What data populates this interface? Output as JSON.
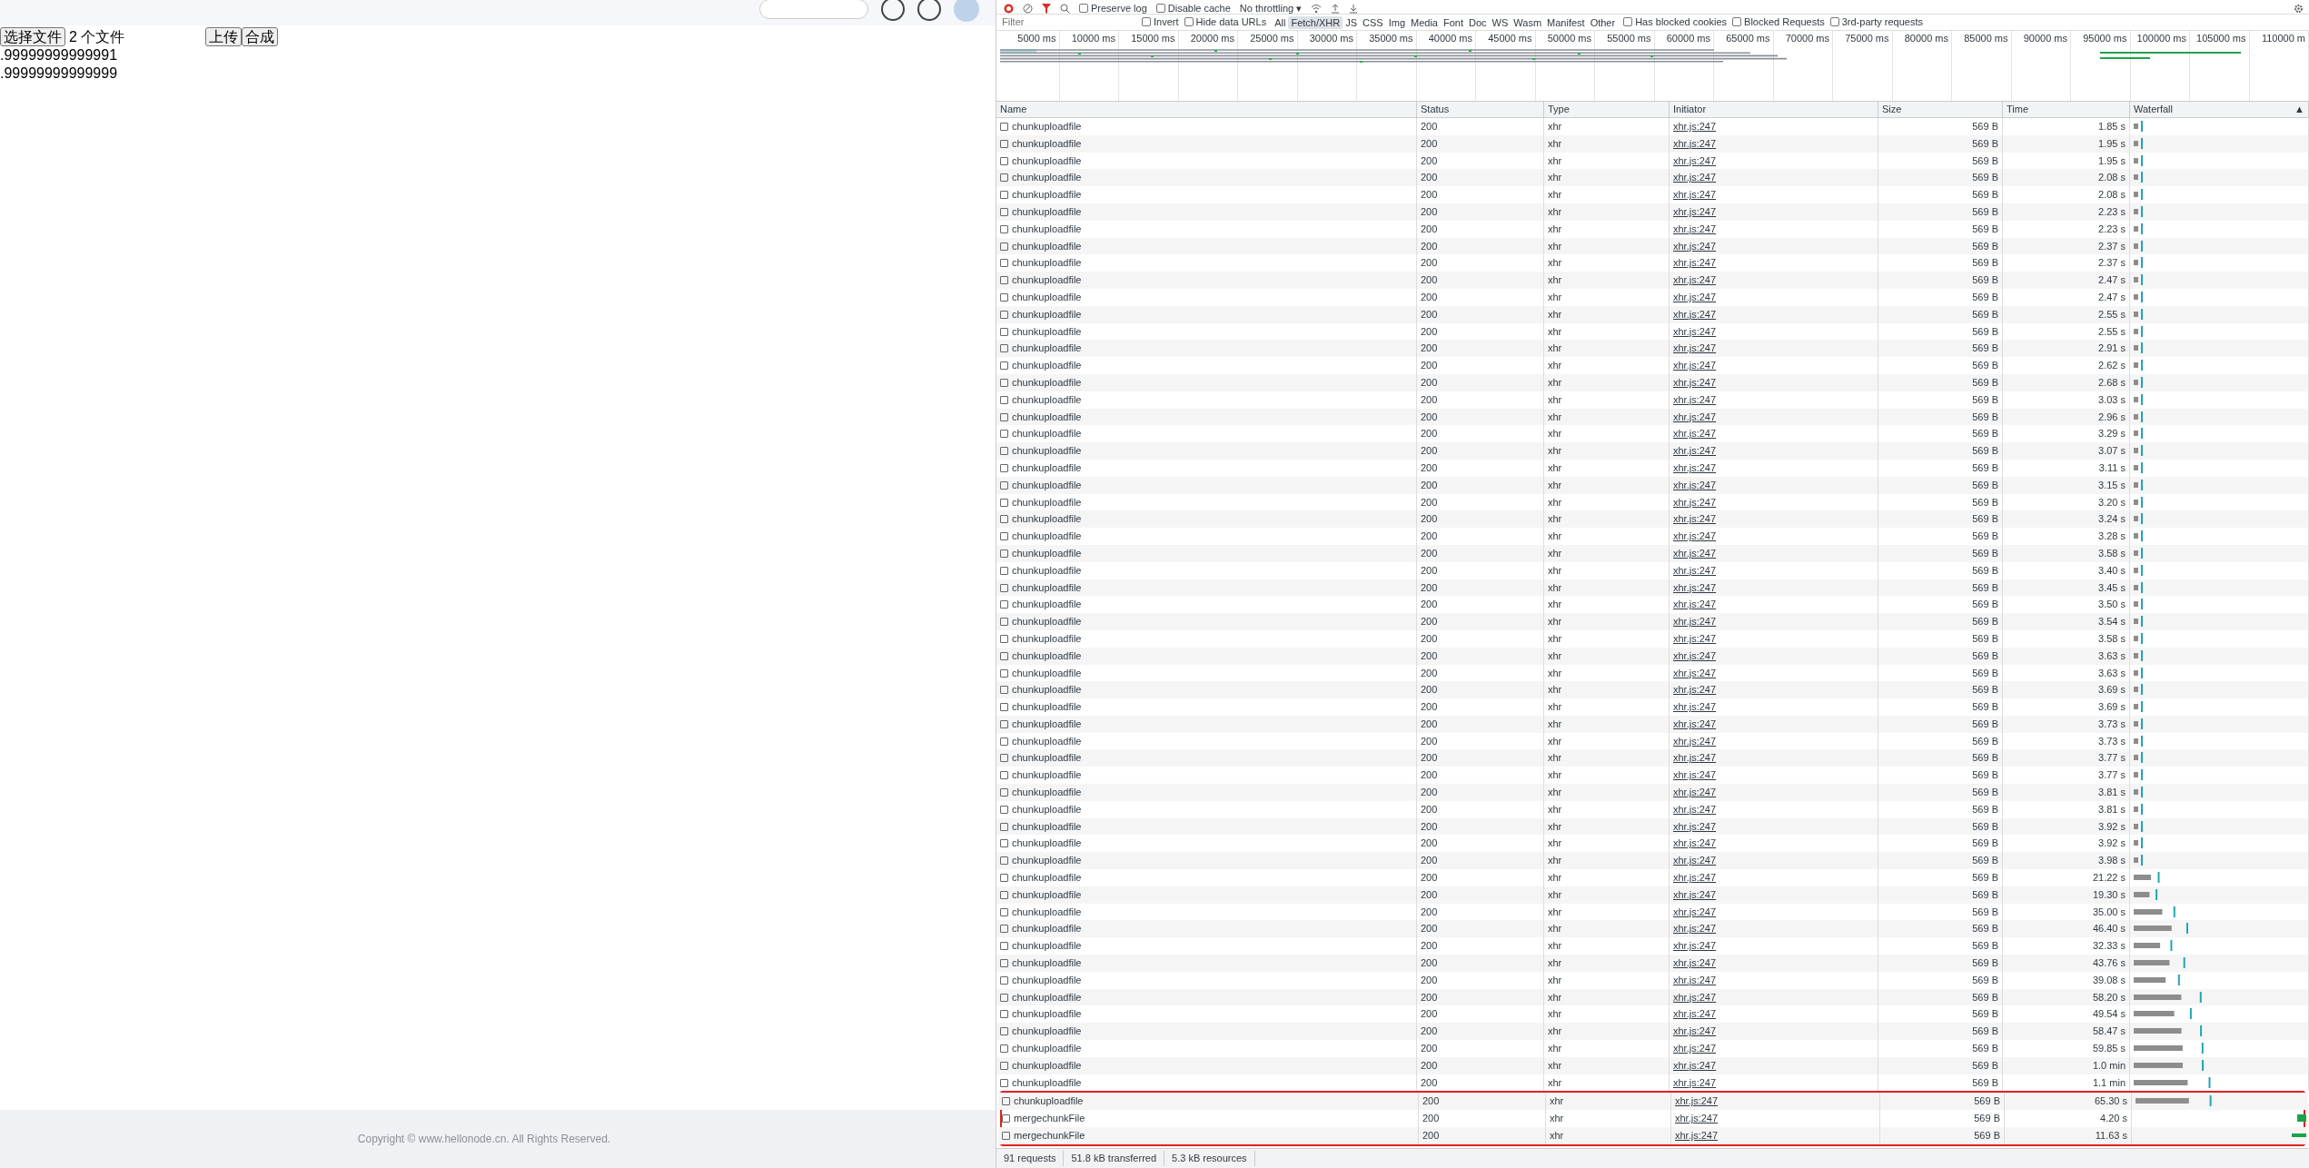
{
  "page": {
    "file_button": "选择文件",
    "file_count": "2 个文件",
    "upload_button": "上传",
    "merge_button": "合成",
    "progress_lines": [
      ".99999999999991",
      ".99999999999999"
    ],
    "footer": "Copyright © www.hellonode.cn. All Rights Reserved."
  },
  "devtools": {
    "toolbar": {
      "preserve_log": {
        "label": "Preserve log",
        "checked": false
      },
      "disable_cache": {
        "label": "Disable cache",
        "checked": false
      },
      "throttling": "No throttling",
      "throttling_caret": "▾"
    },
    "filter": {
      "placeholder": "Filter",
      "checks": [
        {
          "label": "Invert",
          "checked": false
        },
        {
          "label": "Hide data URLs",
          "checked": false
        }
      ],
      "types": [
        {
          "label": "All",
          "selected": false
        },
        {
          "label": "Fetch/XHR",
          "selected": true
        },
        {
          "label": "JS",
          "selected": false
        },
        {
          "label": "CSS",
          "selected": false
        },
        {
          "label": "Img",
          "selected": false
        },
        {
          "label": "Media",
          "selected": false
        },
        {
          "label": "Font",
          "selected": false
        },
        {
          "label": "Doc",
          "selected": false
        },
        {
          "label": "WS",
          "selected": false
        },
        {
          "label": "Wasm",
          "selected": false
        },
        {
          "label": "Manifest",
          "selected": false
        },
        {
          "label": "Other",
          "selected": false
        }
      ],
      "checks_right": [
        {
          "label": "Has blocked cookies",
          "checked": false
        },
        {
          "label": "Blocked Requests",
          "checked": false
        },
        {
          "label": "3rd-party requests",
          "checked": false
        }
      ]
    },
    "timeline_ticks": [
      "5000 ms",
      "10000 ms",
      "15000 ms",
      "20000 ms",
      "25000 ms",
      "30000 ms",
      "35000 ms",
      "40000 ms",
      "45000 ms",
      "50000 ms",
      "55000 ms",
      "60000 ms",
      "65000 ms",
      "70000 ms",
      "75000 ms",
      "80000 ms",
      "85000 ms",
      "90000 ms",
      "95000 ms",
      "100000 ms",
      "105000 ms",
      "110000 m"
    ],
    "columns": [
      "Name",
      "Status",
      "Type",
      "Initiator",
      "Size",
      "Time",
      "Waterfall"
    ],
    "sort_indicator": "▲",
    "rows": [
      {
        "name": "chunkuploadfile",
        "status": "200",
        "type": "xhr",
        "initiator": "xhr.js:247",
        "size": "569 B",
        "time": "1.85 s",
        "kind": "chunk",
        "highlighted": false
      },
      {
        "name": "chunkuploadfile",
        "status": "200",
        "type": "xhr",
        "initiator": "xhr.js:247",
        "size": "569 B",
        "time": "1.95 s",
        "kind": "chunk",
        "highlighted": false
      },
      {
        "name": "chunkuploadfile",
        "status": "200",
        "type": "xhr",
        "initiator": "xhr.js:247",
        "size": "569 B",
        "time": "1.95 s",
        "kind": "chunk",
        "highlighted": false
      },
      {
        "name": "chunkuploadfile",
        "status": "200",
        "type": "xhr",
        "initiator": "xhr.js:247",
        "size": "569 B",
        "time": "2.08 s",
        "kind": "chunk",
        "highlighted": false
      },
      {
        "name": "chunkuploadfile",
        "status": "200",
        "type": "xhr",
        "initiator": "xhr.js:247",
        "size": "569 B",
        "time": "2.08 s",
        "kind": "chunk",
        "highlighted": false
      },
      {
        "name": "chunkuploadfile",
        "status": "200",
        "type": "xhr",
        "initiator": "xhr.js:247",
        "size": "569 B",
        "time": "2.23 s",
        "kind": "chunk",
        "highlighted": false
      },
      {
        "name": "chunkuploadfile",
        "status": "200",
        "type": "xhr",
        "initiator": "xhr.js:247",
        "size": "569 B",
        "time": "2.23 s",
        "kind": "chunk",
        "highlighted": false
      },
      {
        "name": "chunkuploadfile",
        "status": "200",
        "type": "xhr",
        "initiator": "xhr.js:247",
        "size": "569 B",
        "time": "2.37 s",
        "kind": "chunk",
        "highlighted": false
      },
      {
        "name": "chunkuploadfile",
        "status": "200",
        "type": "xhr",
        "initiator": "xhr.js:247",
        "size": "569 B",
        "time": "2.37 s",
        "kind": "chunk",
        "highlighted": false
      },
      {
        "name": "chunkuploadfile",
        "status": "200",
        "type": "xhr",
        "initiator": "xhr.js:247",
        "size": "569 B",
        "time": "2.47 s",
        "kind": "chunk",
        "highlighted": false
      },
      {
        "name": "chunkuploadfile",
        "status": "200",
        "type": "xhr",
        "initiator": "xhr.js:247",
        "size": "569 B",
        "time": "2.47 s",
        "kind": "chunk",
        "highlighted": false
      },
      {
        "name": "chunkuploadfile",
        "status": "200",
        "type": "xhr",
        "initiator": "xhr.js:247",
        "size": "569 B",
        "time": "2.55 s",
        "kind": "chunk",
        "highlighted": false
      },
      {
        "name": "chunkuploadfile",
        "status": "200",
        "type": "xhr",
        "initiator": "xhr.js:247",
        "size": "569 B",
        "time": "2.55 s",
        "kind": "chunk",
        "highlighted": false
      },
      {
        "name": "chunkuploadfile",
        "status": "200",
        "type": "xhr",
        "initiator": "xhr.js:247",
        "size": "569 B",
        "time": "2.91 s",
        "kind": "chunk",
        "highlighted": false
      },
      {
        "name": "chunkuploadfile",
        "status": "200",
        "type": "xhr",
        "initiator": "xhr.js:247",
        "size": "569 B",
        "time": "2.62 s",
        "kind": "chunk",
        "highlighted": false
      },
      {
        "name": "chunkuploadfile",
        "status": "200",
        "type": "xhr",
        "initiator": "xhr.js:247",
        "size": "569 B",
        "time": "2.68 s",
        "kind": "chunk",
        "highlighted": false
      },
      {
        "name": "chunkuploadfile",
        "status": "200",
        "type": "xhr",
        "initiator": "xhr.js:247",
        "size": "569 B",
        "time": "3.03 s",
        "kind": "chunk",
        "highlighted": false
      },
      {
        "name": "chunkuploadfile",
        "status": "200",
        "type": "xhr",
        "initiator": "xhr.js:247",
        "size": "569 B",
        "time": "2.96 s",
        "kind": "chunk",
        "highlighted": false
      },
      {
        "name": "chunkuploadfile",
        "status": "200",
        "type": "xhr",
        "initiator": "xhr.js:247",
        "size": "569 B",
        "time": "3.29 s",
        "kind": "chunk",
        "highlighted": false
      },
      {
        "name": "chunkuploadfile",
        "status": "200",
        "type": "xhr",
        "initiator": "xhr.js:247",
        "size": "569 B",
        "time": "3.07 s",
        "kind": "chunk",
        "highlighted": false
      },
      {
        "name": "chunkuploadfile",
        "status": "200",
        "type": "xhr",
        "initiator": "xhr.js:247",
        "size": "569 B",
        "time": "3.11 s",
        "kind": "chunk",
        "highlighted": false
      },
      {
        "name": "chunkuploadfile",
        "status": "200",
        "type": "xhr",
        "initiator": "xhr.js:247",
        "size": "569 B",
        "time": "3.15 s",
        "kind": "chunk",
        "highlighted": false
      },
      {
        "name": "chunkuploadfile",
        "status": "200",
        "type": "xhr",
        "initiator": "xhr.js:247",
        "size": "569 B",
        "time": "3.20 s",
        "kind": "chunk",
        "highlighted": false
      },
      {
        "name": "chunkuploadfile",
        "status": "200",
        "type": "xhr",
        "initiator": "xhr.js:247",
        "size": "569 B",
        "time": "3.24 s",
        "kind": "chunk",
        "highlighted": false
      },
      {
        "name": "chunkuploadfile",
        "status": "200",
        "type": "xhr",
        "initiator": "xhr.js:247",
        "size": "569 B",
        "time": "3.28 s",
        "kind": "chunk",
        "highlighted": false
      },
      {
        "name": "chunkuploadfile",
        "status": "200",
        "type": "xhr",
        "initiator": "xhr.js:247",
        "size": "569 B",
        "time": "3.58 s",
        "kind": "chunk",
        "highlighted": false
      },
      {
        "name": "chunkuploadfile",
        "status": "200",
        "type": "xhr",
        "initiator": "xhr.js:247",
        "size": "569 B",
        "time": "3.40 s",
        "kind": "chunk",
        "highlighted": false
      },
      {
        "name": "chunkuploadfile",
        "status": "200",
        "type": "xhr",
        "initiator": "xhr.js:247",
        "size": "569 B",
        "time": "3.45 s",
        "kind": "chunk",
        "highlighted": false
      },
      {
        "name": "chunkuploadfile",
        "status": "200",
        "type": "xhr",
        "initiator": "xhr.js:247",
        "size": "569 B",
        "time": "3.50 s",
        "kind": "chunk",
        "highlighted": false
      },
      {
        "name": "chunkuploadfile",
        "status": "200",
        "type": "xhr",
        "initiator": "xhr.js:247",
        "size": "569 B",
        "time": "3.54 s",
        "kind": "chunk",
        "highlighted": false
      },
      {
        "name": "chunkuploadfile",
        "status": "200",
        "type": "xhr",
        "initiator": "xhr.js:247",
        "size": "569 B",
        "time": "3.58 s",
        "kind": "chunk",
        "highlighted": false
      },
      {
        "name": "chunkuploadfile",
        "status": "200",
        "type": "xhr",
        "initiator": "xhr.js:247",
        "size": "569 B",
        "time": "3.63 s",
        "kind": "chunk",
        "highlighted": false
      },
      {
        "name": "chunkuploadfile",
        "status": "200",
        "type": "xhr",
        "initiator": "xhr.js:247",
        "size": "569 B",
        "time": "3.63 s",
        "kind": "chunk",
        "highlighted": false
      },
      {
        "name": "chunkuploadfile",
        "status": "200",
        "type": "xhr",
        "initiator": "xhr.js:247",
        "size": "569 B",
        "time": "3.69 s",
        "kind": "chunk",
        "highlighted": false
      },
      {
        "name": "chunkuploadfile",
        "status": "200",
        "type": "xhr",
        "initiator": "xhr.js:247",
        "size": "569 B",
        "time": "3.69 s",
        "kind": "chunk",
        "highlighted": false
      },
      {
        "name": "chunkuploadfile",
        "status": "200",
        "type": "xhr",
        "initiator": "xhr.js:247",
        "size": "569 B",
        "time": "3.73 s",
        "kind": "chunk",
        "highlighted": false
      },
      {
        "name": "chunkuploadfile",
        "status": "200",
        "type": "xhr",
        "initiator": "xhr.js:247",
        "size": "569 B",
        "time": "3.73 s",
        "kind": "chunk",
        "highlighted": false
      },
      {
        "name": "chunkuploadfile",
        "status": "200",
        "type": "xhr",
        "initiator": "xhr.js:247",
        "size": "569 B",
        "time": "3.77 s",
        "kind": "chunk",
        "highlighted": false
      },
      {
        "name": "chunkuploadfile",
        "status": "200",
        "type": "xhr",
        "initiator": "xhr.js:247",
        "size": "569 B",
        "time": "3.77 s",
        "kind": "chunk",
        "highlighted": false
      },
      {
        "name": "chunkuploadfile",
        "status": "200",
        "type": "xhr",
        "initiator": "xhr.js:247",
        "size": "569 B",
        "time": "3.81 s",
        "kind": "chunk",
        "highlighted": false
      },
      {
        "name": "chunkuploadfile",
        "status": "200",
        "type": "xhr",
        "initiator": "xhr.js:247",
        "size": "569 B",
        "time": "3.81 s",
        "kind": "chunk",
        "highlighted": false
      },
      {
        "name": "chunkuploadfile",
        "status": "200",
        "type": "xhr",
        "initiator": "xhr.js:247",
        "size": "569 B",
        "time": "3.92 s",
        "kind": "chunk",
        "highlighted": false
      },
      {
        "name": "chunkuploadfile",
        "status": "200",
        "type": "xhr",
        "initiator": "xhr.js:247",
        "size": "569 B",
        "time": "3.92 s",
        "kind": "chunk",
        "highlighted": false
      },
      {
        "name": "chunkuploadfile",
        "status": "200",
        "type": "xhr",
        "initiator": "xhr.js:247",
        "size": "569 B",
        "time": "3.98 s",
        "kind": "chunk",
        "highlighted": false
      },
      {
        "name": "chunkuploadfile",
        "status": "200",
        "type": "xhr",
        "initiator": "xhr.js:247",
        "size": "569 B",
        "time": "21.22 s",
        "kind": "chunk",
        "highlighted": false
      },
      {
        "name": "chunkuploadfile",
        "status": "200",
        "type": "xhr",
        "initiator": "xhr.js:247",
        "size": "569 B",
        "time": "19.30 s",
        "kind": "chunk",
        "highlighted": false
      },
      {
        "name": "chunkuploadfile",
        "status": "200",
        "type": "xhr",
        "initiator": "xhr.js:247",
        "size": "569 B",
        "time": "35.00 s",
        "kind": "chunk",
        "highlighted": false
      },
      {
        "name": "chunkuploadfile",
        "status": "200",
        "type": "xhr",
        "initiator": "xhr.js:247",
        "size": "569 B",
        "time": "46.40 s",
        "kind": "chunk",
        "highlighted": false
      },
      {
        "name": "chunkuploadfile",
        "status": "200",
        "type": "xhr",
        "initiator": "xhr.js:247",
        "size": "569 B",
        "time": "32.33 s",
        "kind": "chunk",
        "highlighted": false
      },
      {
        "name": "chunkuploadfile",
        "status": "200",
        "type": "xhr",
        "initiator": "xhr.js:247",
        "size": "569 B",
        "time": "43.76 s",
        "kind": "chunk",
        "highlighted": false
      },
      {
        "name": "chunkuploadfile",
        "status": "200",
        "type": "xhr",
        "initiator": "xhr.js:247",
        "size": "569 B",
        "time": "39.08 s",
        "kind": "chunk",
        "highlighted": false
      },
      {
        "name": "chunkuploadfile",
        "status": "200",
        "type": "xhr",
        "initiator": "xhr.js:247",
        "size": "569 B",
        "time": "58.20 s",
        "kind": "chunk",
        "highlighted": false
      },
      {
        "name": "chunkuploadfile",
        "status": "200",
        "type": "xhr",
        "initiator": "xhr.js:247",
        "size": "569 B",
        "time": "49.54 s",
        "kind": "chunk",
        "highlighted": false
      },
      {
        "name": "chunkuploadfile",
        "status": "200",
        "type": "xhr",
        "initiator": "xhr.js:247",
        "size": "569 B",
        "time": "58.47 s",
        "kind": "chunk",
        "highlighted": false
      },
      {
        "name": "chunkuploadfile",
        "status": "200",
        "type": "xhr",
        "initiator": "xhr.js:247",
        "size": "569 B",
        "time": "59.85 s",
        "kind": "chunk",
        "highlighted": false
      },
      {
        "name": "chunkuploadfile",
        "status": "200",
        "type": "xhr",
        "initiator": "xhr.js:247",
        "size": "569 B",
        "time": "1.0 min",
        "kind": "chunk",
        "highlighted": false
      },
      {
        "name": "chunkuploadfile",
        "status": "200",
        "type": "xhr",
        "initiator": "xhr.js:247",
        "size": "569 B",
        "time": "1.1 min",
        "kind": "chunk",
        "highlighted": false
      },
      {
        "name": "chunkuploadfile",
        "status": "200",
        "type": "xhr",
        "initiator": "xhr.js:247",
        "size": "569 B",
        "time": "65.30 s",
        "kind": "chunk",
        "highlighted": true
      },
      {
        "name": "mergechunkFile",
        "status": "200",
        "type": "xhr",
        "initiator": "xhr.js:247",
        "size": "569 B",
        "time": "4.20 s",
        "kind": "merge",
        "highlighted": true
      },
      {
        "name": "mergechunkFile",
        "status": "200",
        "type": "xhr",
        "initiator": "xhr.js:247",
        "size": "569 B",
        "time": "11.63 s",
        "kind": "merge",
        "highlighted": true
      }
    ],
    "status_bar": [
      "91 requests",
      "51.8 kB transferred",
      "5.3 kB resources"
    ]
  }
}
